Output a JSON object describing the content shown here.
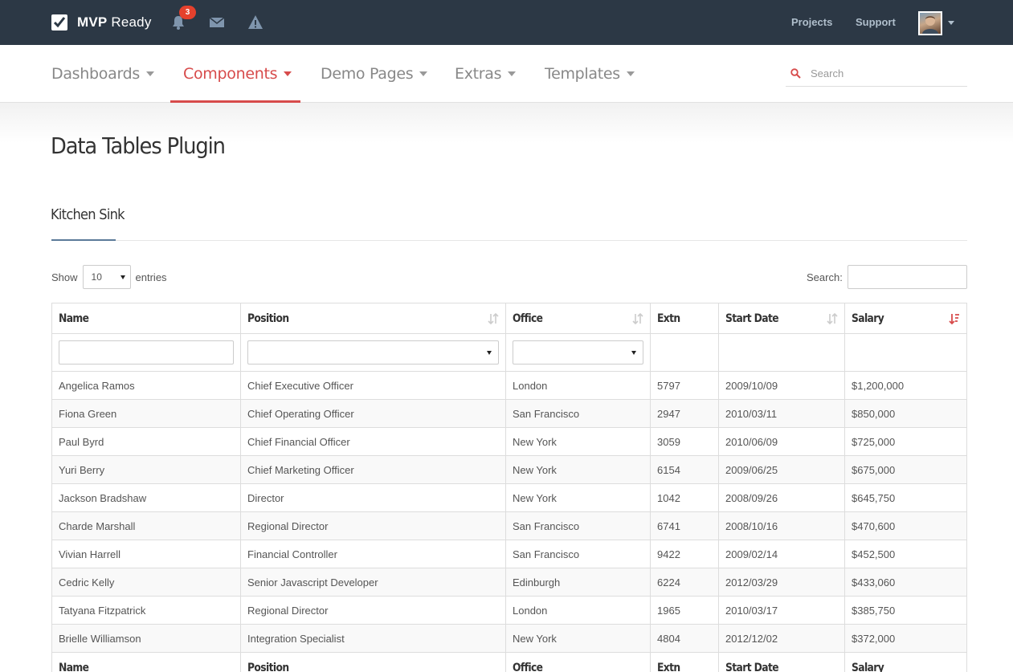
{
  "topbar": {
    "brand_bold": "MVP",
    "brand_light": " Ready",
    "notification_count": "3",
    "links": [
      "Projects",
      "Support"
    ],
    "icons": [
      "bell-icon",
      "envelope-icon",
      "warning-icon"
    ]
  },
  "nav": {
    "items": [
      "Dashboards",
      "Components",
      "Demo Pages",
      "Extras",
      "Templates"
    ],
    "active": "Components",
    "search_placeholder": "Search",
    "accent_color": "#d74b4b"
  },
  "page": {
    "title": "Data Tables Plugin",
    "section_title": "Kitchen Sink"
  },
  "table_controls": {
    "show_label": "Show",
    "length_value": "10",
    "entries_label": "entries",
    "search_label": "Search:"
  },
  "table": {
    "columns": [
      "Name",
      "Position",
      "Office",
      "Extn",
      "Start Date",
      "Salary"
    ],
    "sorted_column": "Salary",
    "sort_direction": "descending",
    "rows": [
      [
        "Angelica Ramos",
        "Chief Executive Officer",
        "London",
        "5797",
        "2009/10/09",
        "$1,200,000"
      ],
      [
        "Fiona Green",
        "Chief Operating Officer",
        "San Francisco",
        "2947",
        "2010/03/11",
        "$850,000"
      ],
      [
        "Paul Byrd",
        "Chief Financial Officer",
        "New York",
        "3059",
        "2010/06/09",
        "$725,000"
      ],
      [
        "Yuri Berry",
        "Chief Marketing Officer",
        "New York",
        "6154",
        "2009/06/25",
        "$675,000"
      ],
      [
        "Jackson Bradshaw",
        "Director",
        "New York",
        "1042",
        "2008/09/26",
        "$645,750"
      ],
      [
        "Charde Marshall",
        "Regional Director",
        "San Francisco",
        "6741",
        "2008/10/16",
        "$470,600"
      ],
      [
        "Vivian Harrell",
        "Financial Controller",
        "San Francisco",
        "9422",
        "2009/02/14",
        "$452,500"
      ],
      [
        "Cedric Kelly",
        "Senior Javascript Developer",
        "Edinburgh",
        "6224",
        "2012/03/29",
        "$433,060"
      ],
      [
        "Tatyana Fitzpatrick",
        "Regional Director",
        "London",
        "1965",
        "2010/03/17",
        "$385,750"
      ],
      [
        "Brielle Williamson",
        "Integration Specialist",
        "New York",
        "4804",
        "2012/12/02",
        "$372,000"
      ]
    ]
  }
}
